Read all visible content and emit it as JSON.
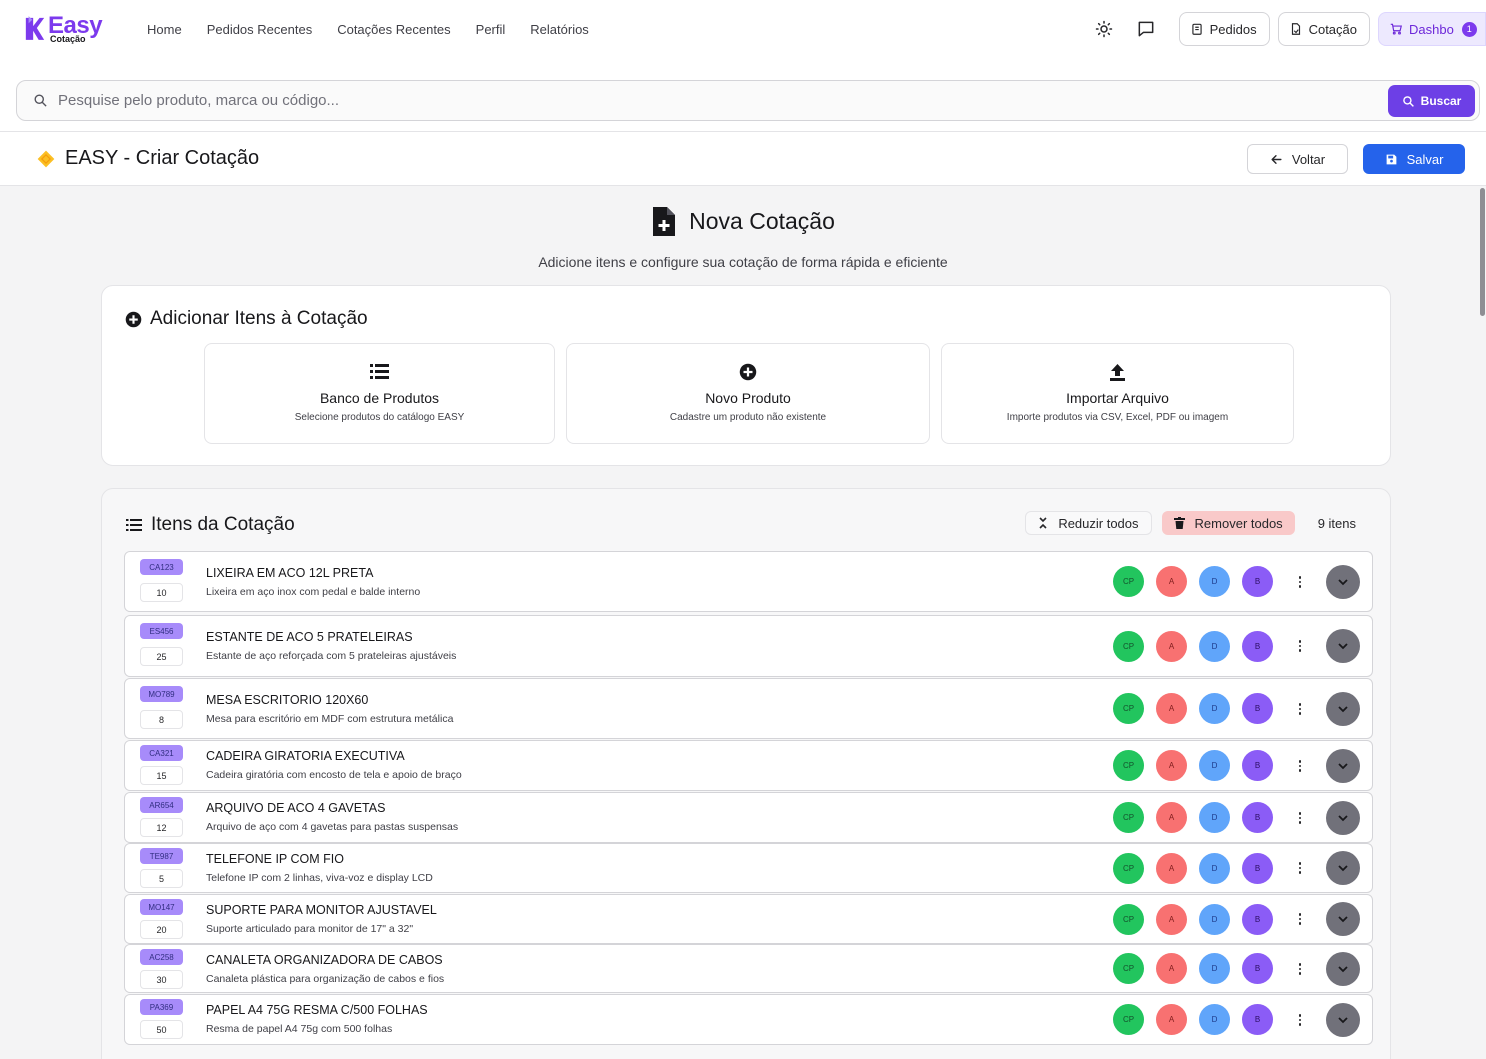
{
  "brand": {
    "name": "Easy",
    "sub": "Cotação"
  },
  "nav": [
    "Home",
    "Pedidos Recentes",
    "Cotações Recentes",
    "Perfil",
    "Relatórios"
  ],
  "top_actions": {
    "pedidos": "Pedidos",
    "cotacao": "Cotação",
    "dashboard": "Dashbo",
    "dashboard_badge": "1"
  },
  "search": {
    "placeholder": "Pesquise pelo produto, marca ou código...",
    "button": "Buscar"
  },
  "header": {
    "title": "EASY - Criar Cotação",
    "back": "Voltar",
    "save": "Salvar"
  },
  "hero": {
    "title": "Nova Cotação",
    "subtitle": "Adicione itens e configure sua cotação de forma rápida e eficiente"
  },
  "add_section": {
    "title": "Adicionar Itens à Cotação",
    "options": [
      {
        "title": "Banco de Produtos",
        "desc": "Selecione produtos do catálogo EASY",
        "icon": "list-icon"
      },
      {
        "title": "Novo Produto",
        "desc": "Cadastre um produto não existente",
        "icon": "plus-circle-icon"
      },
      {
        "title": "Importar Arquivo",
        "desc": "Importe produtos via CSV, Excel, PDF ou imagem",
        "icon": "upload-icon"
      }
    ]
  },
  "items_section": {
    "title": "Itens da Cotação",
    "collapse_all": "Reduzir todos",
    "remove_all": "Remover todos",
    "count": "9 itens"
  },
  "chips": [
    "CP",
    "A",
    "D",
    "B"
  ],
  "items": [
    {
      "code": "CA123",
      "qty": "10",
      "name": "LIXEIRA EM ACO 12L PRETA",
      "desc": "Lixeira em aço inox com pedal e balde interno"
    },
    {
      "code": "ES456",
      "qty": "25",
      "name": "ESTANTE DE ACO 5 PRATELEIRAS",
      "desc": "Estante de aço reforçada com 5 prateleiras ajustáveis"
    },
    {
      "code": "MO789",
      "qty": "8",
      "name": "MESA ESCRITORIO 120X60",
      "desc": "Mesa para escritório em MDF com estrutura metálica"
    },
    {
      "code": "CA321",
      "qty": "15",
      "name": "CADEIRA GIRATORIA EXECUTIVA",
      "desc": "Cadeira giratória com encosto de tela e apoio de braço"
    },
    {
      "code": "AR654",
      "qty": "12",
      "name": "ARQUIVO DE ACO 4 GAVETAS",
      "desc": "Arquivo de aço com 4 gavetas para pastas suspensas"
    },
    {
      "code": "TE987",
      "qty": "5",
      "name": "TELEFONE IP COM FIO",
      "desc": "Telefone IP com 2 linhas, viva-voz e display LCD"
    },
    {
      "code": "MO147",
      "qty": "20",
      "name": "SUPORTE PARA MONITOR AJUSTAVEL",
      "desc": "Suporte articulado para monitor de 17\" a 32\""
    },
    {
      "code": "AC258",
      "qty": "30",
      "name": "CANALETA ORGANIZADORA DE CABOS",
      "desc": "Canaleta plástica para organização de cabos e fios"
    },
    {
      "code": "PA369",
      "qty": "50",
      "name": "PAPEL A4 75G RESMA C/500 FOLHAS",
      "desc": "Resma de papel A4 75g com 500 folhas"
    }
  ],
  "colors": {
    "brand": "#7c3aed",
    "primary": "#2563eb",
    "search_button": "#6d3fe6",
    "cp": "#22c55e",
    "a": "#f87171",
    "d": "#60a5fa",
    "b": "#8b5cf6"
  }
}
